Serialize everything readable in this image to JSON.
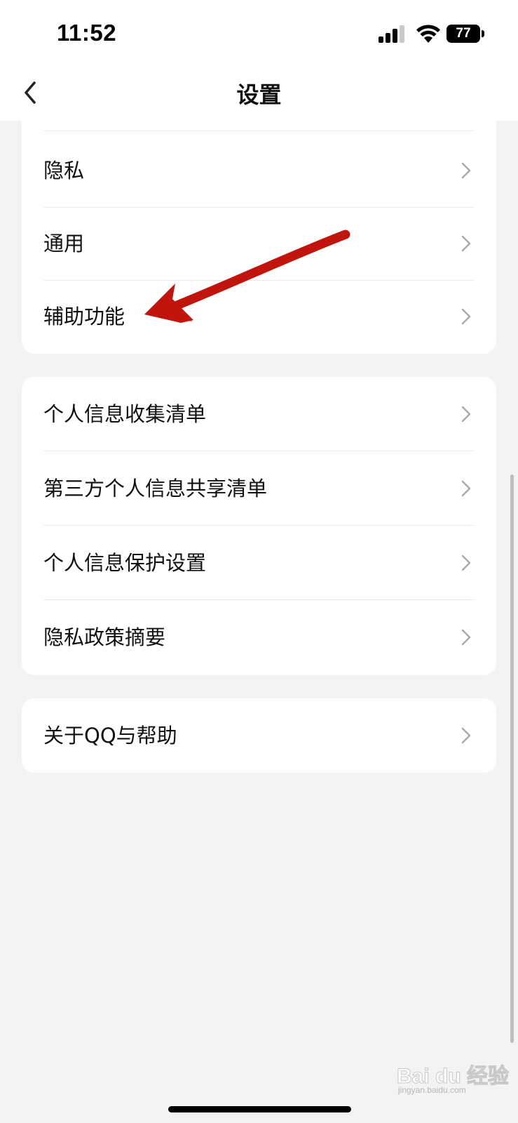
{
  "status_bar": {
    "time": "11:52",
    "battery": "77"
  },
  "nav": {
    "title": "设置"
  },
  "groups": [
    {
      "items": [
        {
          "label": "隐私"
        },
        {
          "label": "通用"
        },
        {
          "label": "辅助功能"
        }
      ]
    },
    {
      "items": [
        {
          "label": "个人信息收集清单"
        },
        {
          "label": "第三方个人信息共享清单"
        },
        {
          "label": "个人信息保护设置"
        },
        {
          "label": "隐私政策摘要"
        }
      ]
    },
    {
      "items": [
        {
          "label": "关于QQ与帮助"
        }
      ]
    }
  ],
  "annotation": {
    "color": "#c1140c"
  },
  "watermark": {
    "main": "Bai du 经验",
    "sub": "jingyan.baidu.com"
  }
}
